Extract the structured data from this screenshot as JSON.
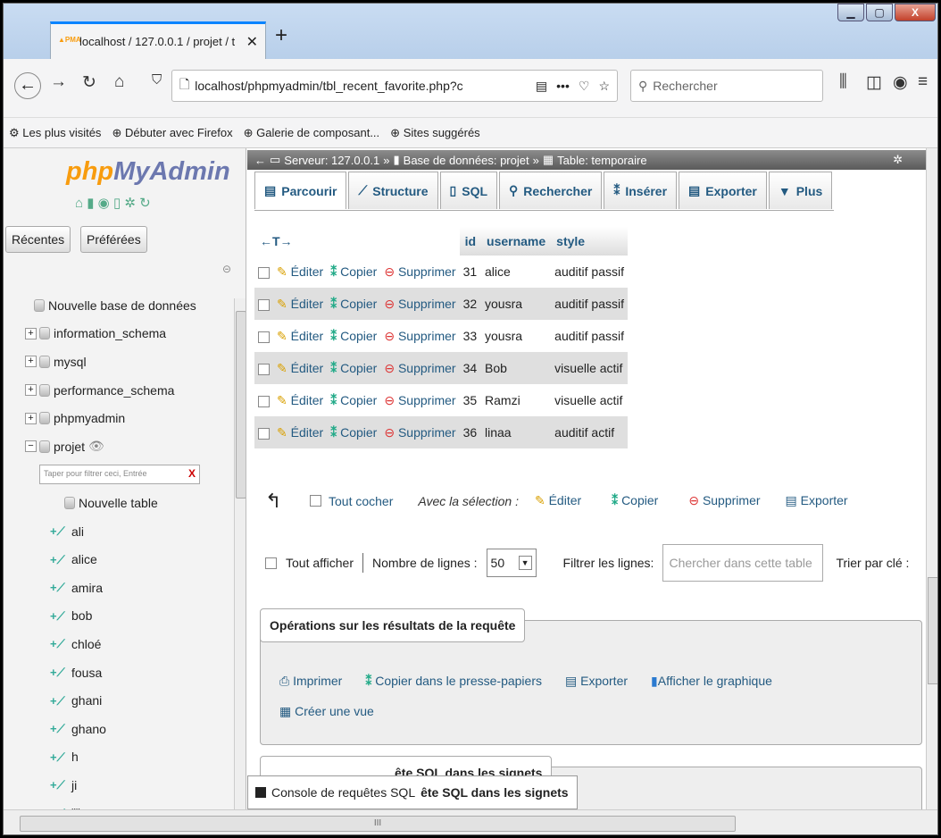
{
  "browser": {
    "tab_title": "localhost / 127.0.0.1 / projet / t",
    "url": "localhost/phpmyadmin/tbl_recent_favorite.php?c",
    "search_placeholder": "Rechercher",
    "bookmarks": [
      "Les plus visités",
      "Débuter avec Firefox",
      "Galerie de composant...",
      "Sites suggérés"
    ]
  },
  "sidebar": {
    "logo_php": "php",
    "logo_myadmin": "MyAdmin",
    "recent_label": "Récentes",
    "favorites_label": "Préférées",
    "new_db": "Nouvelle base de données",
    "databases": [
      "information_schema",
      "mysql",
      "performance_schema",
      "phpmyadmin",
      "projet"
    ],
    "filter_placeholder": "Taper pour filtrer ceci, Entrée",
    "new_table": "Nouvelle table",
    "tables": [
      "ali",
      "alice",
      "amira",
      "bob",
      "chloé",
      "fousa",
      "ghani",
      "ghano",
      "h",
      "ji",
      "iiii"
    ]
  },
  "breadcrumb": {
    "server": "Serveur: 127.0.0.1",
    "database": "Base de données: projet",
    "table": "Table: temporaire"
  },
  "menu": {
    "browse": "Parcourir",
    "structure": "Structure",
    "sql": "SQL",
    "search": "Rechercher",
    "insert": "Insérer",
    "export": "Exporter",
    "more": "Plus"
  },
  "grid": {
    "arrows": "←T→",
    "headers": [
      "id",
      "username",
      "style"
    ],
    "edit": "Éditer",
    "copy": "Copier",
    "delete": "Supprimer",
    "rows": [
      {
        "id": "31",
        "username": "alice",
        "style": "auditif passif"
      },
      {
        "id": "32",
        "username": "yousra",
        "style": "auditif passif"
      },
      {
        "id": "33",
        "username": "yousra",
        "style": "auditif passif"
      },
      {
        "id": "34",
        "username": "Bob",
        "style": "visuelle actif"
      },
      {
        "id": "35",
        "username": "Ramzi",
        "style": "visuelle actif"
      },
      {
        "id": "36",
        "username": "linaa",
        "style": "auditif actif"
      }
    ]
  },
  "bulk": {
    "check_all": "Tout cocher",
    "with_selection": "Avec la sélection :",
    "edit": "Éditer",
    "copy": "Copier",
    "delete": "Supprimer",
    "export": "Exporter"
  },
  "nav": {
    "show_all": "Tout afficher",
    "rows_label": "Nombre de lignes :",
    "rows_value": "50",
    "filter_label": "Filtrer les lignes:",
    "filter_placeholder": "Chercher dans cette table",
    "sort_label": "Trier par clé :"
  },
  "operations": {
    "legend": "Opérations sur les résultats de la requête",
    "print": "Imprimer",
    "copy_clipboard": "Copier dans le presse-papiers",
    "export": "Exporter",
    "chart": "Afficher le graphique",
    "create_view": "Créer une vue"
  },
  "bookmark_legend": "ête SQL dans les signets",
  "console_label": "Console de requêtes SQL",
  "hscroll_label": "III"
}
